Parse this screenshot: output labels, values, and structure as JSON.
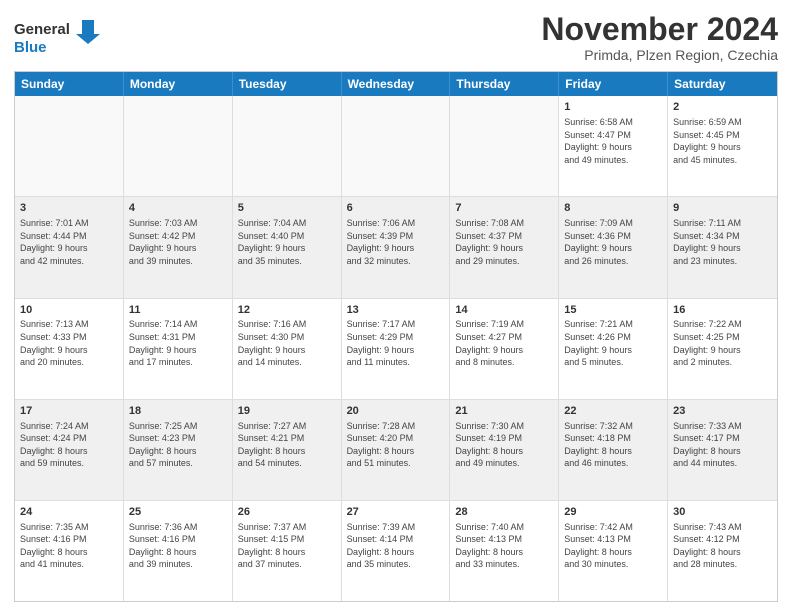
{
  "logo": {
    "line1": "General",
    "line2": "Blue"
  },
  "title": "November 2024",
  "location": "Primda, Plzen Region, Czechia",
  "header_days": [
    "Sunday",
    "Monday",
    "Tuesday",
    "Wednesday",
    "Thursday",
    "Friday",
    "Saturday"
  ],
  "weeks": [
    [
      {
        "day": "",
        "info": ""
      },
      {
        "day": "",
        "info": ""
      },
      {
        "day": "",
        "info": ""
      },
      {
        "day": "",
        "info": ""
      },
      {
        "day": "",
        "info": ""
      },
      {
        "day": "1",
        "info": "Sunrise: 6:58 AM\nSunset: 4:47 PM\nDaylight: 9 hours\nand 49 minutes."
      },
      {
        "day": "2",
        "info": "Sunrise: 6:59 AM\nSunset: 4:45 PM\nDaylight: 9 hours\nand 45 minutes."
      }
    ],
    [
      {
        "day": "3",
        "info": "Sunrise: 7:01 AM\nSunset: 4:44 PM\nDaylight: 9 hours\nand 42 minutes."
      },
      {
        "day": "4",
        "info": "Sunrise: 7:03 AM\nSunset: 4:42 PM\nDaylight: 9 hours\nand 39 minutes."
      },
      {
        "day": "5",
        "info": "Sunrise: 7:04 AM\nSunset: 4:40 PM\nDaylight: 9 hours\nand 35 minutes."
      },
      {
        "day": "6",
        "info": "Sunrise: 7:06 AM\nSunset: 4:39 PM\nDaylight: 9 hours\nand 32 minutes."
      },
      {
        "day": "7",
        "info": "Sunrise: 7:08 AM\nSunset: 4:37 PM\nDaylight: 9 hours\nand 29 minutes."
      },
      {
        "day": "8",
        "info": "Sunrise: 7:09 AM\nSunset: 4:36 PM\nDaylight: 9 hours\nand 26 minutes."
      },
      {
        "day": "9",
        "info": "Sunrise: 7:11 AM\nSunset: 4:34 PM\nDaylight: 9 hours\nand 23 minutes."
      }
    ],
    [
      {
        "day": "10",
        "info": "Sunrise: 7:13 AM\nSunset: 4:33 PM\nDaylight: 9 hours\nand 20 minutes."
      },
      {
        "day": "11",
        "info": "Sunrise: 7:14 AM\nSunset: 4:31 PM\nDaylight: 9 hours\nand 17 minutes."
      },
      {
        "day": "12",
        "info": "Sunrise: 7:16 AM\nSunset: 4:30 PM\nDaylight: 9 hours\nand 14 minutes."
      },
      {
        "day": "13",
        "info": "Sunrise: 7:17 AM\nSunset: 4:29 PM\nDaylight: 9 hours\nand 11 minutes."
      },
      {
        "day": "14",
        "info": "Sunrise: 7:19 AM\nSunset: 4:27 PM\nDaylight: 9 hours\nand 8 minutes."
      },
      {
        "day": "15",
        "info": "Sunrise: 7:21 AM\nSunset: 4:26 PM\nDaylight: 9 hours\nand 5 minutes."
      },
      {
        "day": "16",
        "info": "Sunrise: 7:22 AM\nSunset: 4:25 PM\nDaylight: 9 hours\nand 2 minutes."
      }
    ],
    [
      {
        "day": "17",
        "info": "Sunrise: 7:24 AM\nSunset: 4:24 PM\nDaylight: 8 hours\nand 59 minutes."
      },
      {
        "day": "18",
        "info": "Sunrise: 7:25 AM\nSunset: 4:23 PM\nDaylight: 8 hours\nand 57 minutes."
      },
      {
        "day": "19",
        "info": "Sunrise: 7:27 AM\nSunset: 4:21 PM\nDaylight: 8 hours\nand 54 minutes."
      },
      {
        "day": "20",
        "info": "Sunrise: 7:28 AM\nSunset: 4:20 PM\nDaylight: 8 hours\nand 51 minutes."
      },
      {
        "day": "21",
        "info": "Sunrise: 7:30 AM\nSunset: 4:19 PM\nDaylight: 8 hours\nand 49 minutes."
      },
      {
        "day": "22",
        "info": "Sunrise: 7:32 AM\nSunset: 4:18 PM\nDaylight: 8 hours\nand 46 minutes."
      },
      {
        "day": "23",
        "info": "Sunrise: 7:33 AM\nSunset: 4:17 PM\nDaylight: 8 hours\nand 44 minutes."
      }
    ],
    [
      {
        "day": "24",
        "info": "Sunrise: 7:35 AM\nSunset: 4:16 PM\nDaylight: 8 hours\nand 41 minutes."
      },
      {
        "day": "25",
        "info": "Sunrise: 7:36 AM\nSunset: 4:16 PM\nDaylight: 8 hours\nand 39 minutes."
      },
      {
        "day": "26",
        "info": "Sunrise: 7:37 AM\nSunset: 4:15 PM\nDaylight: 8 hours\nand 37 minutes."
      },
      {
        "day": "27",
        "info": "Sunrise: 7:39 AM\nSunset: 4:14 PM\nDaylight: 8 hours\nand 35 minutes."
      },
      {
        "day": "28",
        "info": "Sunrise: 7:40 AM\nSunset: 4:13 PM\nDaylight: 8 hours\nand 33 minutes."
      },
      {
        "day": "29",
        "info": "Sunrise: 7:42 AM\nSunset: 4:13 PM\nDaylight: 8 hours\nand 30 minutes."
      },
      {
        "day": "30",
        "info": "Sunrise: 7:43 AM\nSunset: 4:12 PM\nDaylight: 8 hours\nand 28 minutes."
      }
    ]
  ]
}
